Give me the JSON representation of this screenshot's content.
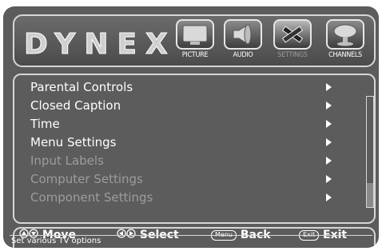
{
  "brand": {
    "logo": "DYNEX"
  },
  "tabs": [
    {
      "label": "PICTURE",
      "icon": "tv-screen-icon",
      "selected": false
    },
    {
      "label": "AUDIO",
      "icon": "speaker-icon",
      "selected": false
    },
    {
      "label": "SETTINGS",
      "icon": "tools-icon",
      "selected": true
    },
    {
      "label": "CHANNELS",
      "icon": "satellite-dish-icon",
      "selected": false
    }
  ],
  "menu": {
    "items": [
      {
        "label": "Parental Controls",
        "enabled": true
      },
      {
        "label": "Closed Caption",
        "enabled": true
      },
      {
        "label": "Time",
        "enabled": true
      },
      {
        "label": "Menu Settings",
        "enabled": true
      },
      {
        "label": "Input Labels",
        "enabled": false
      },
      {
        "label": "Computer Settings",
        "enabled": false
      },
      {
        "label": "Component Settings",
        "enabled": false
      }
    ]
  },
  "footer": {
    "move": "Move",
    "select": "Select",
    "menu_key": "Menu",
    "back": "Back",
    "exit_key": "Exit",
    "exit": "Exit"
  },
  "status": {
    "text": "Set various TV options"
  },
  "colors": {
    "background": "#5c5c5c",
    "border": "#d6d6d6",
    "text": "#ffffff",
    "disabled_text": "#9c9c9c"
  }
}
